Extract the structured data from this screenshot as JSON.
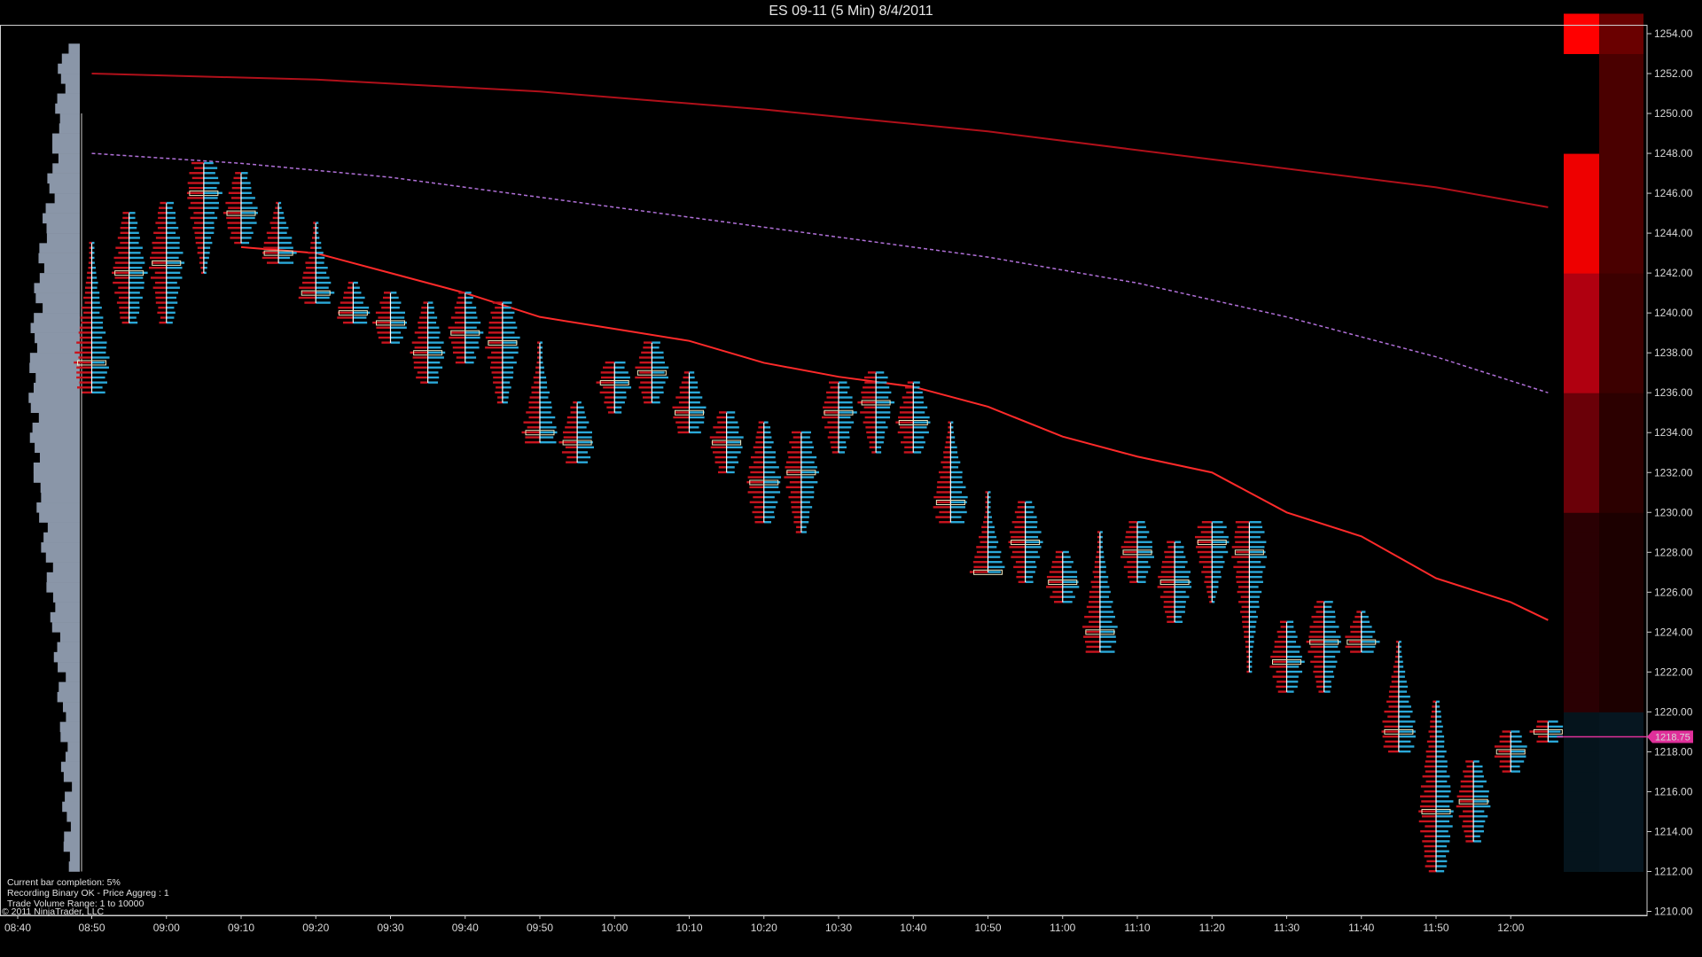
{
  "window": {
    "title": "ES 09-11 (5 Min)  8/4/2011"
  },
  "info": {
    "line1": "Current bar completion: 5%",
    "line2": "Recording Binary OK - Price Aggreg : 1",
    "line3": "Trade Volume Range: 1 to 10000"
  },
  "copyright": "© 2011 NinjaTrader, LLC",
  "colors": {
    "background": "#000000",
    "ask_volume": "#2aa8d8",
    "bid_volume": "#c8141e",
    "moving_average_fast": "#ff2a2a",
    "moving_average_slow": "#b0101a",
    "moving_average_dotted": "#b070d8",
    "price_marker": "#e0309a",
    "session_profile": "#8a96a8"
  },
  "chart_data": {
    "type": "volume-profile-candles",
    "title": "ES 09-11 (5 Min)  8/4/2011",
    "ylim": [
      1210,
      1255
    ],
    "y_ticks": [
      "1210.00",
      "1212.00",
      "1214.00",
      "1216.00",
      "1218.00",
      "1220.00",
      "1222.00",
      "1224.00",
      "1226.00",
      "1228.00",
      "1230.00",
      "1232.00",
      "1234.00",
      "1236.00",
      "1238.00",
      "1240.00",
      "1242.00",
      "1244.00",
      "1246.00",
      "1248.00",
      "1250.00",
      "1252.00",
      "1254.00"
    ],
    "x_ticks": [
      "08:40",
      "08:50",
      "09:00",
      "09:10",
      "09:20",
      "09:30",
      "09:40",
      "09:50",
      "10:00",
      "10:10",
      "10:20",
      "10:30",
      "10:40",
      "10:50",
      "11:00",
      "11:10",
      "11:20",
      "11:30",
      "11:40",
      "11:50",
      "12:00"
    ],
    "last_price": "1218.75",
    "bars": [
      {
        "time": "08:50",
        "high": 1243.5,
        "low": 1236.0,
        "poc": 1237.5
      },
      {
        "time": "08:55",
        "high": 1245.0,
        "low": 1239.5,
        "poc": 1242.0
      },
      {
        "time": "09:00",
        "high": 1245.5,
        "low": 1239.5,
        "poc": 1242.5
      },
      {
        "time": "09:05",
        "high": 1247.5,
        "low": 1242.0,
        "poc": 1246.0
      },
      {
        "time": "09:10",
        "high": 1247.0,
        "low": 1243.5,
        "poc": 1245.0
      },
      {
        "time": "09:15",
        "high": 1245.5,
        "low": 1242.5,
        "poc": 1243.0
      },
      {
        "time": "09:20",
        "high": 1244.5,
        "low": 1240.5,
        "poc": 1241.0
      },
      {
        "time": "09:25",
        "high": 1241.5,
        "low": 1239.5,
        "poc": 1240.0
      },
      {
        "time": "09:30",
        "high": 1241.0,
        "low": 1238.5,
        "poc": 1239.5
      },
      {
        "time": "09:35",
        "high": 1240.5,
        "low": 1236.5,
        "poc": 1238.0
      },
      {
        "time": "09:40",
        "high": 1241.0,
        "low": 1237.5,
        "poc": 1239.0
      },
      {
        "time": "09:45",
        "high": 1240.5,
        "low": 1235.5,
        "poc": 1238.5
      },
      {
        "time": "09:50",
        "high": 1238.5,
        "low": 1233.5,
        "poc": 1234.0
      },
      {
        "time": "09:55",
        "high": 1235.5,
        "low": 1232.5,
        "poc": 1233.5
      },
      {
        "time": "10:00",
        "high": 1237.5,
        "low": 1235.0,
        "poc": 1236.5
      },
      {
        "time": "10:05",
        "high": 1238.5,
        "low": 1235.5,
        "poc": 1237.0
      },
      {
        "time": "10:10",
        "high": 1237.0,
        "low": 1234.0,
        "poc": 1235.0
      },
      {
        "time": "10:15",
        "high": 1235.0,
        "low": 1232.0,
        "poc": 1233.5
      },
      {
        "time": "10:20",
        "high": 1234.5,
        "low": 1229.5,
        "poc": 1231.5
      },
      {
        "time": "10:25",
        "high": 1234.0,
        "low": 1229.0,
        "poc": 1232.0
      },
      {
        "time": "10:30",
        "high": 1236.5,
        "low": 1233.0,
        "poc": 1235.0
      },
      {
        "time": "10:35",
        "high": 1237.0,
        "low": 1233.0,
        "poc": 1235.5
      },
      {
        "time": "10:40",
        "high": 1236.5,
        "low": 1233.0,
        "poc": 1234.5
      },
      {
        "time": "10:45",
        "high": 1234.5,
        "low": 1229.5,
        "poc": 1230.5
      },
      {
        "time": "10:50",
        "high": 1231.0,
        "low": 1227.0,
        "poc": 1227.0
      },
      {
        "time": "10:55",
        "high": 1230.5,
        "low": 1226.5,
        "poc": 1228.5
      },
      {
        "time": "11:00",
        "high": 1228.0,
        "low": 1225.5,
        "poc": 1226.5
      },
      {
        "time": "11:05",
        "high": 1229.0,
        "low": 1223.0,
        "poc": 1224.0
      },
      {
        "time": "11:10",
        "high": 1229.5,
        "low": 1226.5,
        "poc": 1228.0
      },
      {
        "time": "11:15",
        "high": 1228.5,
        "low": 1224.5,
        "poc": 1226.5
      },
      {
        "time": "11:20",
        "high": 1229.5,
        "low": 1225.5,
        "poc": 1228.5
      },
      {
        "time": "11:25",
        "high": 1229.5,
        "low": 1222.0,
        "poc": 1228.0
      },
      {
        "time": "11:30",
        "high": 1224.5,
        "low": 1221.0,
        "poc": 1222.5
      },
      {
        "time": "11:35",
        "high": 1225.5,
        "low": 1221.0,
        "poc": 1223.5
      },
      {
        "time": "11:40",
        "high": 1225.0,
        "low": 1223.0,
        "poc": 1223.5
      },
      {
        "time": "11:45",
        "high": 1223.5,
        "low": 1218.0,
        "poc": 1219.0
      },
      {
        "time": "11:50",
        "high": 1220.5,
        "low": 1212.0,
        "poc": 1215.0
      },
      {
        "time": "11:55",
        "high": 1217.5,
        "low": 1213.5,
        "poc": 1215.5
      },
      {
        "time": "12:00",
        "high": 1219.0,
        "low": 1217.0,
        "poc": 1218.0
      },
      {
        "time": "12:05",
        "high": 1219.5,
        "low": 1218.5,
        "poc": 1219.0
      }
    ],
    "ma_fast": [
      {
        "time": "09:10",
        "value": 1243.3
      },
      {
        "time": "09:20",
        "value": 1243.0
      },
      {
        "time": "09:30",
        "value": 1242.0
      },
      {
        "time": "09:40",
        "value": 1241.0
      },
      {
        "time": "09:50",
        "value": 1239.8
      },
      {
        "time": "10:00",
        "value": 1239.2
      },
      {
        "time": "10:10",
        "value": 1238.6
      },
      {
        "time": "10:20",
        "value": 1237.5
      },
      {
        "time": "10:30",
        "value": 1236.8
      },
      {
        "time": "10:40",
        "value": 1236.3
      },
      {
        "time": "10:50",
        "value": 1235.3
      },
      {
        "time": "11:00",
        "value": 1233.8
      },
      {
        "time": "11:10",
        "value": 1232.8
      },
      {
        "time": "11:20",
        "value": 1232.0
      },
      {
        "time": "11:30",
        "value": 1230.0
      },
      {
        "time": "11:40",
        "value": 1228.8
      },
      {
        "time": "11:50",
        "value": 1226.7
      },
      {
        "time": "12:00",
        "value": 1225.5
      },
      {
        "time": "12:05",
        "value": 1224.6
      }
    ],
    "ma_slow": [
      {
        "time": "08:50",
        "value": 1252.0
      },
      {
        "time": "09:20",
        "value": 1251.7
      },
      {
        "time": "09:50",
        "value": 1251.1
      },
      {
        "time": "10:20",
        "value": 1250.2
      },
      {
        "time": "10:50",
        "value": 1249.1
      },
      {
        "time": "11:20",
        "value": 1247.7
      },
      {
        "time": "11:50",
        "value": 1246.3
      },
      {
        "time": "12:05",
        "value": 1245.3
      }
    ],
    "ma_dotted": [
      {
        "time": "08:50",
        "value": 1248.0
      },
      {
        "time": "09:10",
        "value": 1247.5
      },
      {
        "time": "09:30",
        "value": 1246.8
      },
      {
        "time": "09:50",
        "value": 1245.8
      },
      {
        "time": "10:10",
        "value": 1244.8
      },
      {
        "time": "10:30",
        "value": 1243.8
      },
      {
        "time": "10:50",
        "value": 1242.8
      },
      {
        "time": "11:10",
        "value": 1241.5
      },
      {
        "time": "11:30",
        "value": 1239.8
      },
      {
        "time": "11:50",
        "value": 1237.8
      },
      {
        "time": "12:05",
        "value": 1236.0
      }
    ]
  }
}
